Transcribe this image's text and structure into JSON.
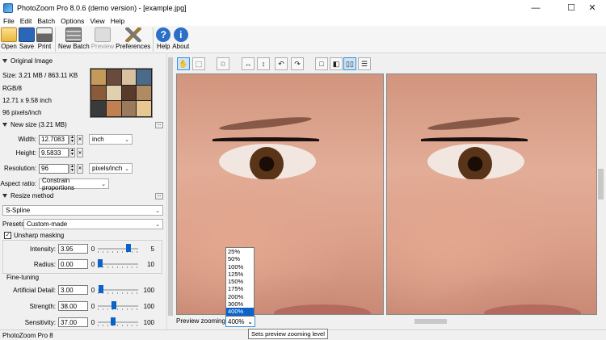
{
  "window": {
    "title": "PhotoZoom Pro 8.0.6 (demo version) - [example.jpg]",
    "minimize": "—",
    "maximize": "☐",
    "close": "✕"
  },
  "menu": [
    "File",
    "Edit",
    "Batch",
    "Options",
    "View",
    "Help"
  ],
  "toolbar": {
    "open": "Open",
    "save": "Save",
    "print": "Print",
    "new_batch": "New Batch",
    "preview": "Preview",
    "preferences": "Preferences",
    "help": "Help",
    "about": "About",
    "help_glyph": "?",
    "about_glyph": "i"
  },
  "original": {
    "header": "Original Image",
    "size": "Size: 3.21 MB / 863.11 KB",
    "mode": "RGB/8",
    "dims": "12.71 x 9.58 inch",
    "res": "96 pixels/inch"
  },
  "newsize": {
    "header": "New size (3.21 MB)",
    "width_label": "Width:",
    "width": "12.7083",
    "height_label": "Height:",
    "height": "9.5833",
    "unit": "inch",
    "resolution_label": "Resolution:",
    "resolution": "96",
    "res_unit": "pixels/inch",
    "aspect_label": "Aspect ratio:",
    "aspect": "Constrain proportions"
  },
  "resize": {
    "header": "Resize method",
    "method": "S-Spline",
    "presets_label": "Presets:",
    "preset": "Custom-made"
  },
  "unsharp": {
    "label": "Unsharp masking",
    "intensity_label": "Intensity:",
    "intensity": "3.95",
    "intensity_min": "0",
    "intensity_max": "5",
    "intensity_level": 0.79,
    "radius_label": "Radius:",
    "radius": "0.00",
    "radius_min": "0",
    "radius_max": "10",
    "radius_level": 0.0
  },
  "finetune": {
    "header": "Fine-tuning",
    "detail_label": "Artificial Detail:",
    "detail": "3.00",
    "detail_min": "0",
    "detail_max": "100",
    "detail_level": 0.03,
    "strength_label": "Strength:",
    "strength": "38.00",
    "strength_min": "0",
    "strength_max": "100",
    "strength_level": 0.38,
    "sensitivity_label": "Sensitivity:",
    "sensitivity": "37.00",
    "sensitivity_min": "0",
    "sensitivity_max": "100",
    "sensitivity_level": 0.37
  },
  "preview": {
    "zoom_label": "Preview zooming:",
    "zoom_value": "400%",
    "zoom_options": [
      "25%",
      "50%",
      "100%",
      "125%",
      "150%",
      "175%",
      "200%",
      "300%",
      "400%"
    ],
    "tooltip": "Sets preview zooming level"
  },
  "status": "PhotoZoom Pro 8",
  "icons": {
    "hand": "hand-icon",
    "select": "selection-icon",
    "crop": "crop-icon"
  }
}
